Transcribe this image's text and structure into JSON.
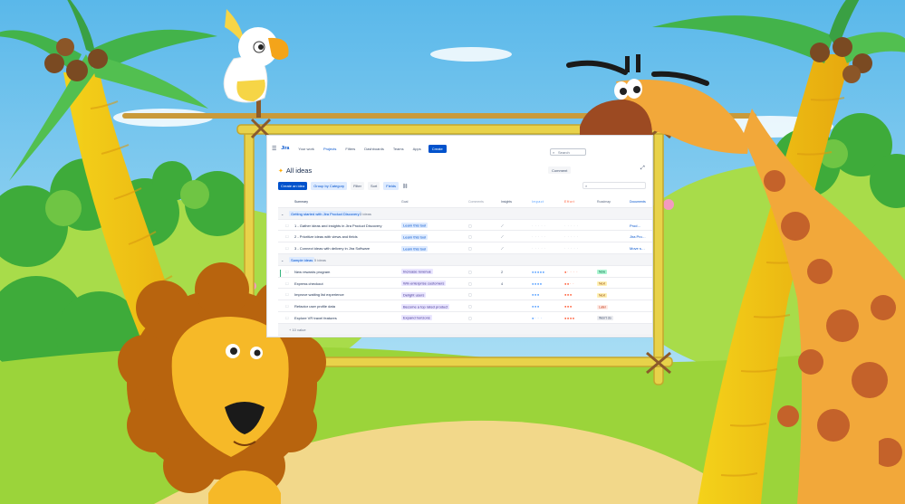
{
  "app": {
    "logo": "Jira",
    "nav": [
      "Your work",
      "Projects",
      "Filters",
      "Dashboards",
      "Teams",
      "Apps"
    ],
    "create_label": "Create",
    "search_placeholder": "Search"
  },
  "page": {
    "title": "All ideas",
    "comment_label": "Comment"
  },
  "toolbar": {
    "create_idea": "Create an idea",
    "group_by": "Group by",
    "group_value": "Category",
    "filter": "Filter",
    "sort": "Sort",
    "fields": "Fields"
  },
  "columns": [
    "Summary",
    "Goal",
    "Comments",
    "Insights",
    "Impact",
    "Effort",
    "Roadmap",
    "Documents"
  ],
  "groups": [
    {
      "label": "Getting started with Jira Product Discovery",
      "count": "3 ideas",
      "rows": [
        {
          "summary": "1 - Gather ideas and insights in Jira Product Discovery",
          "goal": "Learn this tool",
          "impact": "· · · · ·",
          "effort": "· · · · ·",
          "doc": "Prod…"
        },
        {
          "summary": "2 - Prioritize ideas with views and fields",
          "goal": "Learn this tool",
          "impact": "· · · · ·",
          "effort": "· · · · ·",
          "doc": "Jira Pro…"
        },
        {
          "summary": "3 - Connect ideas with delivery in Jira Software",
          "goal": "Learn this tool",
          "impact": "· · · · ·",
          "effort": "· · · · ·",
          "doc": "Move s…"
        }
      ]
    },
    {
      "label": "Sample ideas",
      "count": "5 ideas",
      "rows": [
        {
          "summary": "New rewards program",
          "goal": "Increase revenue",
          "insights": "2",
          "impact": "●●●●●",
          "effort": "●· · · ·",
          "roadmap": "Now",
          "roadmap_kind": "now"
        },
        {
          "summary": "Express checkout",
          "goal": "Win enterprise customers",
          "insights": "4",
          "impact": "●●●●",
          "effort": "●●· ·",
          "roadmap": "Next",
          "roadmap_kind": "next"
        },
        {
          "summary": "Improve waiting list experience",
          "goal": "Delight users",
          "insights": "",
          "impact": "●●●",
          "effort": "●●●",
          "roadmap": "Next",
          "roadmap_kind": "next"
        },
        {
          "summary": "Refactor user profile data",
          "goal": "Become a top rated product",
          "insights": "",
          "impact": "●●●",
          "effort": "●●●",
          "roadmap": "Later",
          "roadmap_kind": "later"
        },
        {
          "summary": "Explore VR travel features",
          "goal": "Expand horizons",
          "insights": "",
          "impact": "●· · ·",
          "effort": "●●●●",
          "roadmap": "Won't do",
          "roadmap_kind": "wont"
        }
      ]
    }
  ],
  "add_row_label": "+ 10 value",
  "colors": {
    "sky": "#7ecbf0",
    "grass": "#9bd43a",
    "sand": "#f2d88a",
    "bamboo": "#e8d24a",
    "jira_blue": "#0052cc"
  }
}
